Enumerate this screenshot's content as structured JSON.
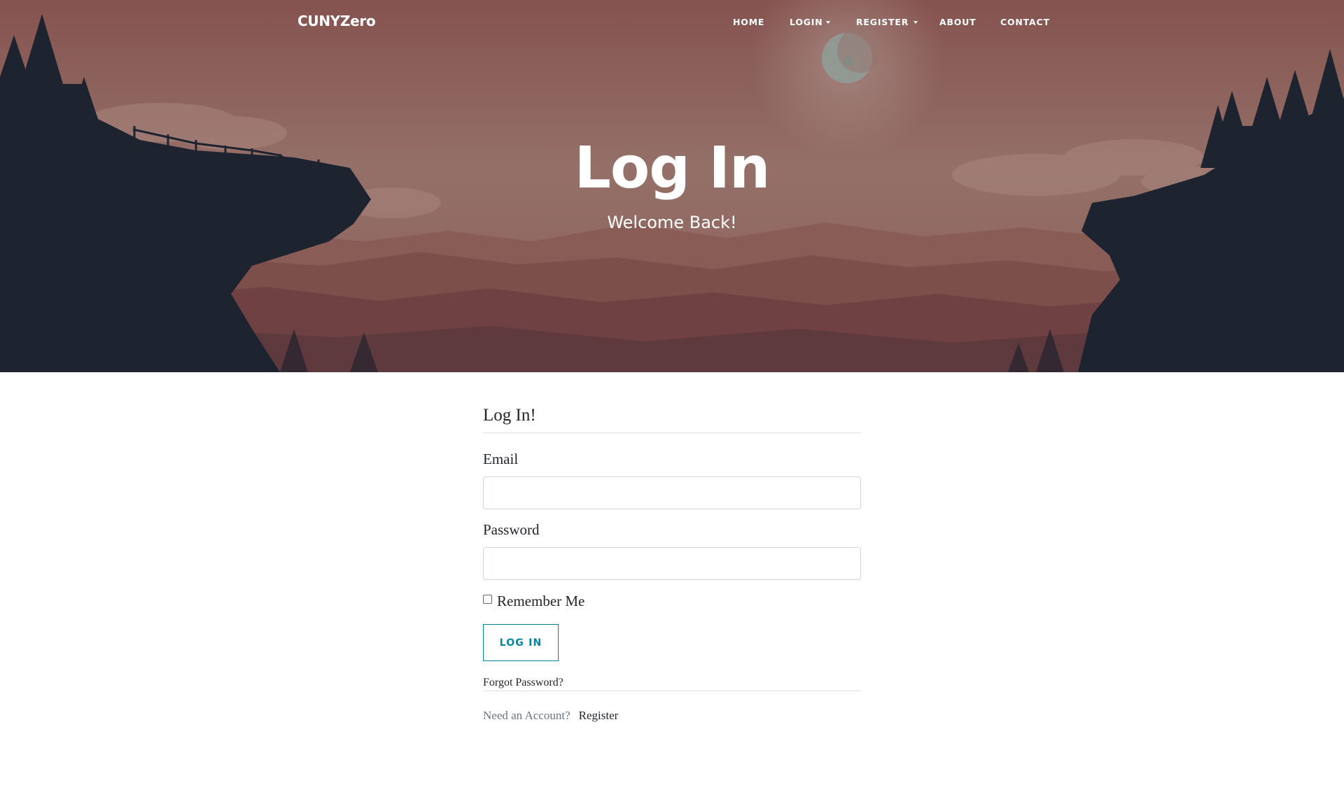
{
  "navbar": {
    "brand": "CUNYZero",
    "items": [
      {
        "label": "HOME",
        "dropdown": false
      },
      {
        "label": "LOGIN",
        "dropdown": true
      },
      {
        "label": "REGISTER",
        "dropdown": true
      },
      {
        "label": "ABOUT",
        "dropdown": false
      },
      {
        "label": "CONTACT",
        "dropdown": false
      }
    ]
  },
  "hero": {
    "title": "Log In",
    "subtitle": "Welcome Back!"
  },
  "form": {
    "legend": "Log In!",
    "email_label": "Email",
    "email_value": "",
    "password_label": "Password",
    "password_value": "",
    "remember_label": "Remember Me",
    "remember_checked": false,
    "submit_label": "LOG IN",
    "forgot_label": "Forgot Password?",
    "need_account_text": "Need an Account?",
    "register_link": "Register"
  },
  "colors": {
    "accent": "#0085a1",
    "sky_top": "#8a5a55",
    "sky_bottom": "#9c7068",
    "cliff": "#1e2330"
  }
}
